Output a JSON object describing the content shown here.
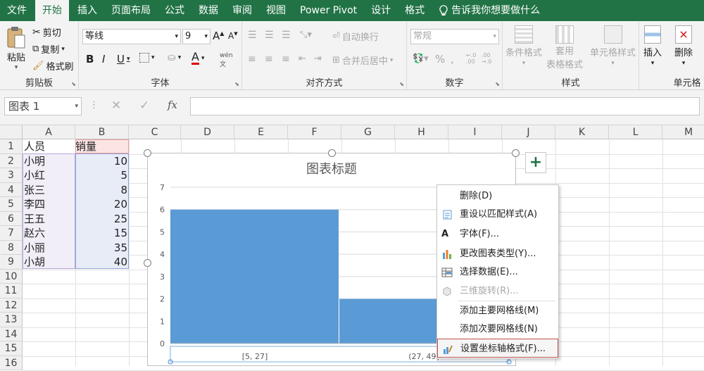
{
  "tabs": [
    "文件",
    "开始",
    "插入",
    "页面布局",
    "公式",
    "数据",
    "审阅",
    "视图",
    "Power Pivot",
    "设计",
    "格式"
  ],
  "tell_me": "告诉我你想要做什么",
  "ribbon": {
    "clipboard": {
      "paste": "粘贴",
      "cut": "剪切",
      "copy": "复制",
      "format_painter": "格式刷",
      "label": "剪贴板"
    },
    "font": {
      "name": "等线",
      "size": "9",
      "bold": "B",
      "italic": "I",
      "underline": "U",
      "label": "字体"
    },
    "alignment": {
      "wrap": "自动换行",
      "merge": "合并后居中",
      "label": "对齐方式"
    },
    "number": {
      "format": "常规",
      "label": "数字"
    },
    "styles": {
      "conditional": "条件格式",
      "table1": "套用",
      "table2": "表格格式",
      "cell_styles": "单元格样式",
      "label": "样式"
    },
    "cells": {
      "insert": "插入",
      "delete": "删除",
      "label": "单元格"
    }
  },
  "formula_bar": {
    "name_box": "图表 1",
    "fx": "fx"
  },
  "columns": [
    "A",
    "B",
    "C",
    "D",
    "E",
    "F",
    "G",
    "H",
    "I",
    "J",
    "K",
    "L",
    "M"
  ],
  "rows": [
    "1",
    "2",
    "3",
    "4",
    "5",
    "6",
    "7",
    "8",
    "9",
    "10",
    "11",
    "12",
    "13",
    "14",
    "15",
    "16"
  ],
  "table": {
    "headers": [
      "人员",
      "销量"
    ],
    "data": [
      [
        "小明",
        "10"
      ],
      [
        "小红",
        "5"
      ],
      [
        "张三",
        "8"
      ],
      [
        "李四",
        "20"
      ],
      [
        "王五",
        "25"
      ],
      [
        "赵六",
        "15"
      ],
      [
        "小丽",
        "35"
      ],
      [
        "小胡",
        "40"
      ]
    ]
  },
  "chart_data": {
    "type": "bar",
    "title": "图表标题",
    "categories": [
      "[5, 27]",
      "(27, 49]"
    ],
    "values": [
      6,
      2
    ],
    "ylim": [
      0,
      7
    ],
    "yticks": [
      "0",
      "1",
      "2",
      "3",
      "4",
      "5",
      "6",
      "7"
    ],
    "bar_color": "#5b9bd5",
    "grid": true
  },
  "context_menu": {
    "items": [
      {
        "label": "删除(D)",
        "disabled": false
      },
      {
        "label": "重设以匹配样式(A)",
        "disabled": false
      },
      {
        "label": "字体(F)...",
        "disabled": false
      },
      {
        "label": "更改图表类型(Y)...",
        "disabled": false
      },
      {
        "label": "选择数据(E)...",
        "disabled": false
      },
      {
        "label": "三维旋转(R)...",
        "disabled": true
      },
      {
        "label": "添加主要网格线(M)",
        "disabled": false
      },
      {
        "label": "添加次要网格线(N)",
        "disabled": false
      },
      {
        "label": "设置坐标轴格式(F)...",
        "disabled": false
      }
    ]
  },
  "chart_side_button": "+",
  "colors": {
    "accent": "#217346",
    "bar": "#5b9bd5",
    "selection_header": "#fce4e4",
    "selection_value": "#e8ecf7"
  }
}
